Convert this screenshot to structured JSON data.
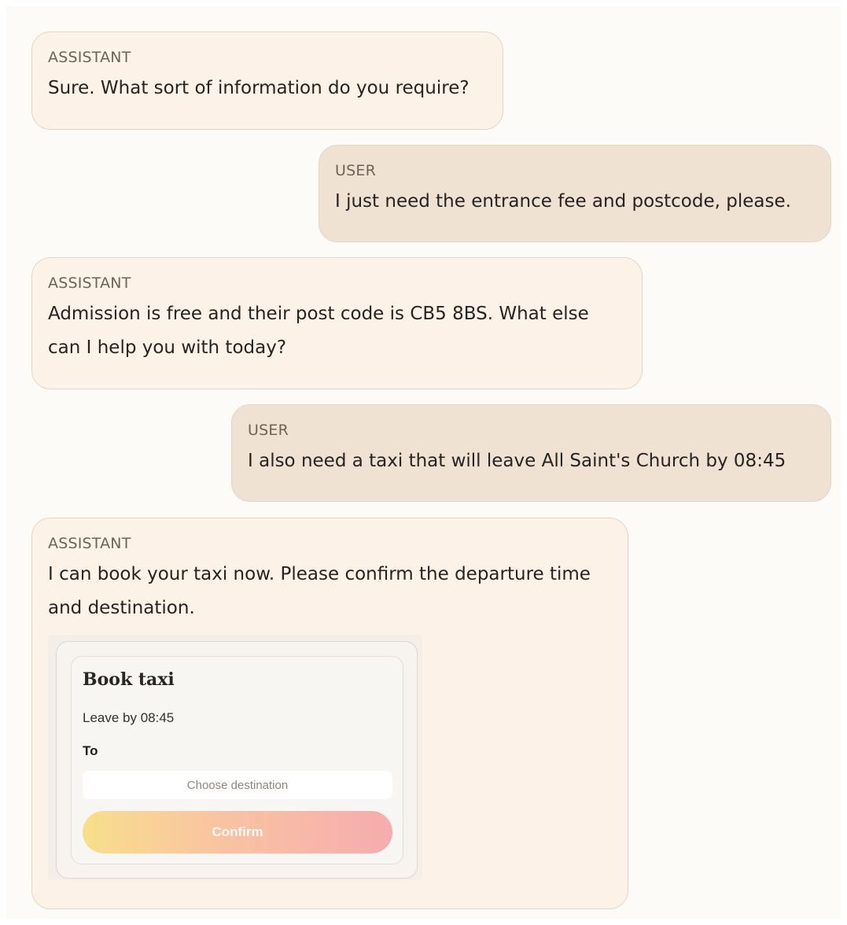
{
  "messages": [
    {
      "role": "ASSISTANT",
      "text": "Sure. What sort of information do you require?"
    },
    {
      "role": "USER",
      "text": "I just need the entrance fee and postcode, please."
    },
    {
      "role": "ASSISTANT",
      "text": "Admission is free and their post code is CB5 8BS. What else can I help you with today?"
    },
    {
      "role": "USER",
      "text": "I also need a taxi that will leave All Saint's Church by 08:45"
    },
    {
      "role": "ASSISTANT",
      "text": "I can book your taxi now. Please confirm the departure time and destination."
    }
  ],
  "taxi_widget": {
    "title": "Book taxi",
    "leave_by": "Leave by 08:45",
    "to_label": "To",
    "destination_placeholder": "Choose destination",
    "destination_value": "",
    "confirm_label": "Confirm"
  }
}
